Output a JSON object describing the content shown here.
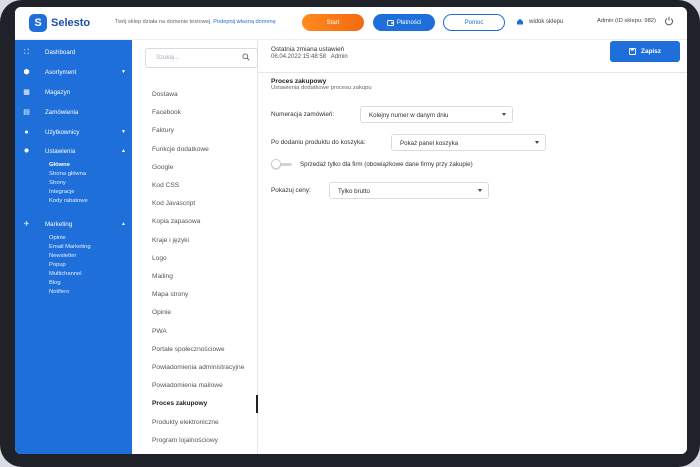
{
  "topbar": {
    "logo_text": "Selesto",
    "notice_text": "Twój sklep działa na domenie testowej.",
    "notice_link": "Podepnij własną domenę",
    "start_label": "Start",
    "payments_label": "Płatności",
    "help_label": "Pomoc",
    "shop_view_label": "widok sklepu",
    "admin_label": "Admin (ID sklepu: 982)"
  },
  "sidebar": {
    "items": [
      {
        "label": "Dashboard",
        "icon": "dashboard-icon"
      },
      {
        "label": "Asortyment",
        "icon": "assortment-icon"
      },
      {
        "label": "Magazyn",
        "icon": "warehouse-icon"
      },
      {
        "label": "Zamówienia",
        "icon": "orders-icon"
      },
      {
        "label": "Użytkownicy",
        "icon": "users-icon"
      },
      {
        "label": "Ustawienia",
        "icon": "settings-icon"
      },
      {
        "label": "Marketing",
        "icon": "marketing-icon"
      }
    ],
    "settings_sub": [
      "Główne",
      "Strona główna",
      "Strony",
      "Integracje",
      "Kody rabatowe"
    ],
    "marketing_sub": [
      "Opinie",
      "Email Marketing",
      "Newsletter",
      "Popup",
      "Multichannel",
      "Blog",
      "Notifero"
    ]
  },
  "navcol": {
    "search_placeholder": "Szukaj...",
    "items": [
      "Dostawa",
      "Facebook",
      "Faktury",
      "Funkcje dodatkowe",
      "Google",
      "Kod CSS",
      "Kod Javascript",
      "Kopia zapasowa",
      "Kraje i języki",
      "Logo",
      "Mailing",
      "Mapa strony",
      "Opinie",
      "PWA",
      "Portale społecznościowe",
      "Powiadomienia administracyjne",
      "Powiadomienia mailowe",
      "Proces zakupowy",
      "Produkty elektroniczne",
      "Program lojalnościowy",
      "Przekierowania 301"
    ],
    "active_index": 17
  },
  "main": {
    "last_change_title": "Ostatnia zmiana ustawień",
    "last_change_date": "06.04.2022  15:48:58",
    "last_change_user": "Admin",
    "save_label": "Zapisz",
    "section_title": "Proces zakupowy",
    "section_subtitle": "Ustawienia dodatkowe procesu zakupu",
    "order_numbering_label": "Numeracja zamówień:",
    "order_numbering_value": "Kolejny numer w danym dniu",
    "after_add_label": "Po dodaniu produktu do koszyka:",
    "after_add_value": "Pokaż panel koszyka",
    "toggle_label": "Sprzedaż tylko dla firm (obowiązkowe dane firmy przy zakupie)",
    "prices_label": "Pokazuj ceny:",
    "prices_value": "Tylko brutto"
  },
  "colors": {
    "brand": "#1e6fd9",
    "accent_orange": "#f36a10"
  }
}
